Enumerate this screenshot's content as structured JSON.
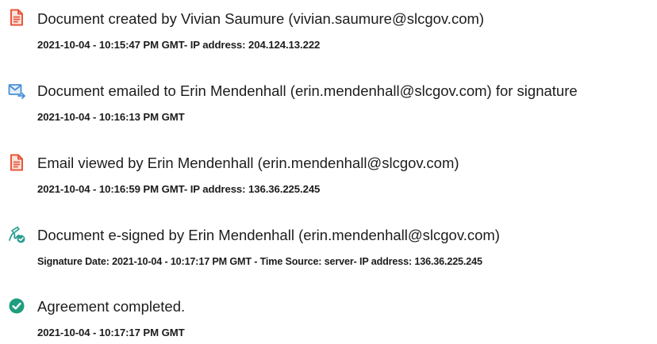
{
  "audit_events": [
    {
      "icon": "document-created-icon",
      "title": "Document created by Vivian Saumure (vivian.saumure@slcgov.com)",
      "detail": "2021-10-04 - 10:15:47 PM GMT- IP address: 204.124.13.222"
    },
    {
      "icon": "email-sent-icon",
      "title": "Document emailed to Erin Mendenhall (erin.mendenhall@slcgov.com) for signature",
      "detail": "2021-10-04 - 10:16:13 PM GMT"
    },
    {
      "icon": "document-viewed-icon",
      "title": "Email viewed by Erin Mendenhall (erin.mendenhall@slcgov.com)",
      "detail": "2021-10-04 - 10:16:59 PM GMT- IP address: 136.36.225.245"
    },
    {
      "icon": "e-signed-icon",
      "title": "Document e-signed by Erin Mendenhall (erin.mendenhall@slcgov.com)",
      "detail": "Signature Date: 2021-10-04 - 10:17:17 PM GMT - Time Source: server- IP address: 136.36.225.245"
    },
    {
      "icon": "completed-check-icon",
      "title": "Agreement completed.",
      "detail": "2021-10-04 - 10:17:17 PM GMT"
    }
  ],
  "colors": {
    "document_icon": "#e8563c",
    "email_icon": "#4a8fd4",
    "sign_icon": "#2a9d8f",
    "check_icon": "#1e9e7e",
    "text": "#1c1c1c"
  }
}
